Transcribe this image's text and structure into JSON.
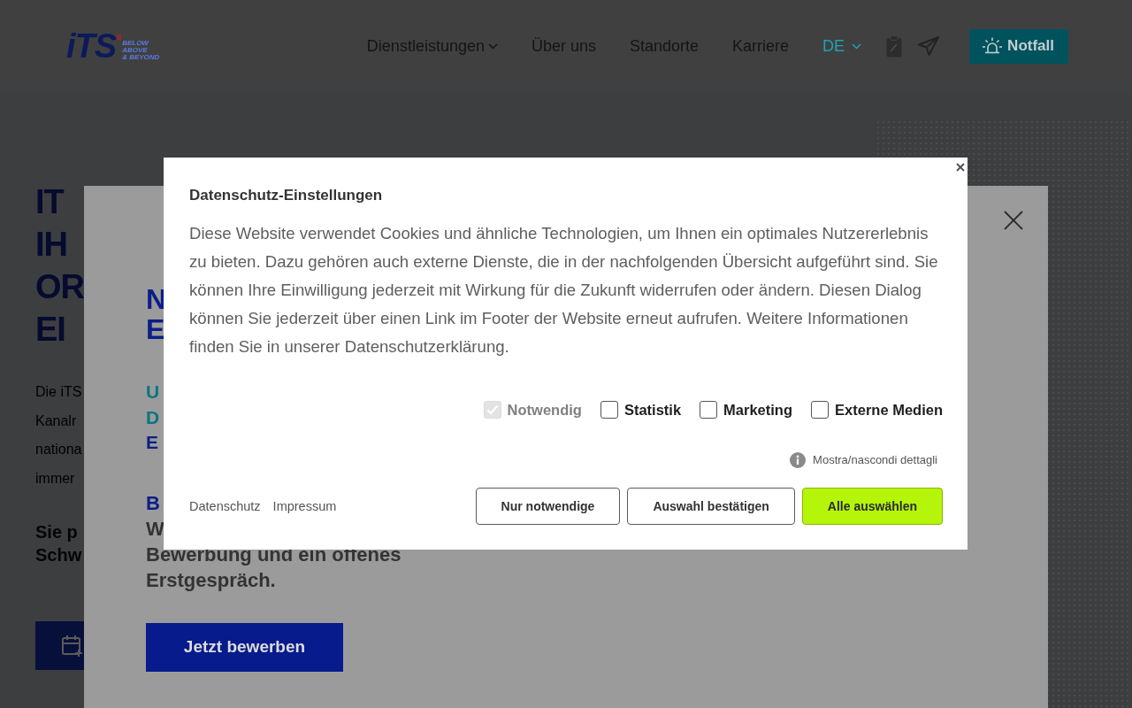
{
  "header": {
    "logo": {
      "wordmark": "iTS",
      "tagline": [
        "BELOW",
        "ABOVE",
        "& BEYOND"
      ]
    },
    "nav": [
      {
        "label": "Dienstleistungen",
        "dropdown": true
      },
      {
        "label": "Über uns",
        "dropdown": false
      },
      {
        "label": "Standorte",
        "dropdown": false
      },
      {
        "label": "Karriere",
        "dropdown": false
      }
    ],
    "language": {
      "label": "DE",
      "dropdown": true
    },
    "emergency_button": {
      "label": "Notfall"
    }
  },
  "hero": {
    "heading_lines": [
      "IT",
      "IH",
      "OR",
      "EI"
    ],
    "text_lines": [
      "Die iTS",
      "Kanalr",
      "nationa",
      "immer"
    ],
    "bold_lines": [
      "Sie p",
      "Schw"
    ]
  },
  "job_panel": {
    "heading_lines": [
      "N",
      "E"
    ],
    "subheading_lines": [
      {
        "text": "U",
        "color": "#0b7582"
      },
      {
        "text": "D",
        "color": "#0b7582"
      },
      {
        "text": "E",
        "color": "#0c1e86"
      }
    ],
    "body_lines": [
      {
        "text": "B",
        "color": "#0c1e86"
      },
      {
        "text": "W",
        "color": "#333333"
      },
      {
        "text": "Bewerbung und ein offenes",
        "color": "#333333"
      },
      {
        "text": "Erstgespräch.",
        "color": "#333333"
      }
    ],
    "apply_button": {
      "label": "Jetzt bewerben"
    }
  },
  "cookie_dialog": {
    "title": "Datenschutz-Einstellungen",
    "text": "Diese Website verwendet Cookies und ähnliche Technologien, um Ihnen ein optimales Nutzererlebnis zu bieten. Dazu gehören auch externe Dienste, die in der nachfolgenden Übersicht aufgeführt sind. Sie können Ihre Einwilligung jederzeit mit Wirkung für die Zukunft widerrufen oder ändern. Diesen Dialog können Sie jederzeit über einen Link im Footer der Website erneut aufrufen. Weitere Informationen finden Sie in unserer Datenschutzerklärung.",
    "categories": [
      {
        "label": "Notwendig",
        "checked": true,
        "disabled": true
      },
      {
        "label": "Statistik",
        "checked": false,
        "disabled": false
      },
      {
        "label": "Marketing",
        "checked": false,
        "disabled": false
      },
      {
        "label": "Externe Medien",
        "checked": false,
        "disabled": false
      }
    ],
    "details_toggle": "Mostra/nascondi dettagli",
    "links": [
      "Datenschutz",
      "Impressum"
    ],
    "buttons": [
      {
        "label": "Nur notwendige",
        "kind": "outline"
      },
      {
        "label": "Auswahl bestätigen",
        "kind": "outline"
      },
      {
        "label": "Alle auswählen",
        "kind": "primary"
      }
    ]
  }
}
